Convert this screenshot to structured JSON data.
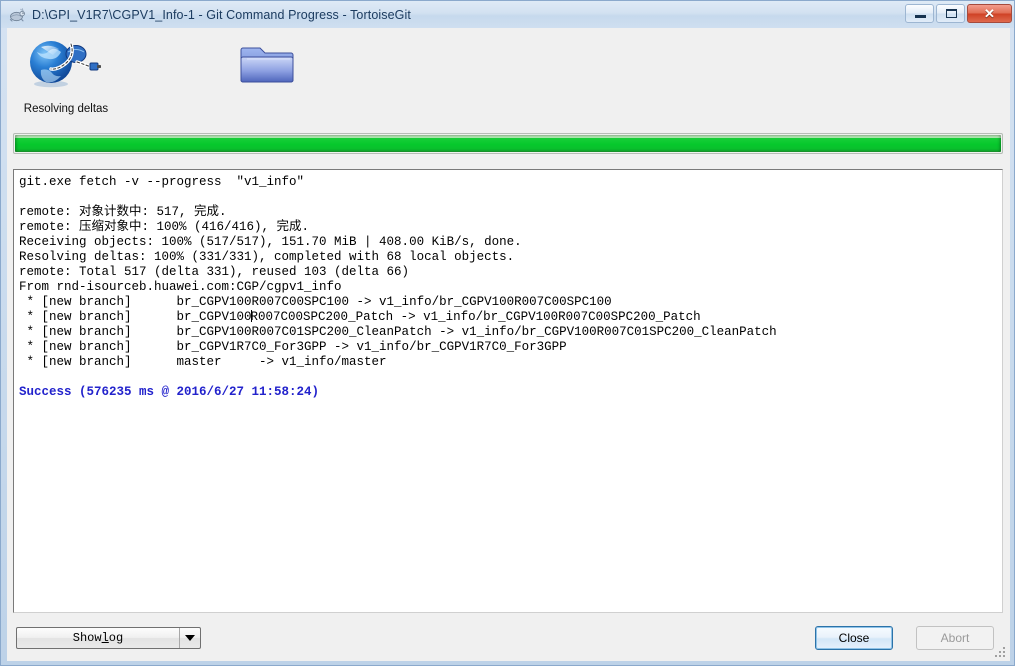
{
  "window": {
    "title": "D:\\GPI_V1R7\\CGPV1_Info-1 - Git Command Progress - TortoiseGit",
    "app_icon": "tortoise-icon",
    "controls": {
      "minimize_label": "Minimize",
      "maximize_label": "Maximize",
      "close_label": "Close"
    },
    "colors": {
      "titlebar": "#d2e1f1",
      "frame_border": "#8ba9cc",
      "dialog_bg": "#f0f0f0",
      "progress_green": "#06c82c",
      "success_text": "#2222cc",
      "default_button_border": "#2c72a8"
    }
  },
  "icons": {
    "network": {
      "name": "globe-network-icon",
      "caption": "Resolving deltas"
    },
    "folder": {
      "name": "folder-icon",
      "caption": ""
    }
  },
  "progress": {
    "percent": 100,
    "value_label": "100%"
  },
  "log": {
    "lines": [
      {
        "text": "git.exe fetch -v --progress  \"v1_info\"",
        "style": "normal"
      },
      {
        "text": "",
        "style": "blank"
      },
      {
        "text": "remote: 对象计数中: 517, 完成.",
        "style": "normal"
      },
      {
        "text": "remote: 压缩对象中: 100% (416/416), 完成.",
        "style": "normal"
      },
      {
        "text": "Receiving objects: 100% (517/517), 151.70 MiB | 408.00 KiB/s, done.",
        "style": "normal"
      },
      {
        "text": "Resolving deltas: 100% (331/331), completed with 68 local objects.",
        "style": "normal"
      },
      {
        "text": "remote: Total 517 (delta 331), reused 103 (delta 66)",
        "style": "normal"
      },
      {
        "text": "From rnd-isourceb.huawei.com:CGP/cgpv1_info",
        "style": "normal"
      },
      {
        "text": " * [new branch]      br_CGPV100R007C00SPC100 -> v1_info/br_CGPV100R007C00SPC100",
        "style": "normal"
      },
      {
        "text": " * [new branch]      br_CGPV100R007C00SPC200_Patch -> v1_info/br_CGPV100R007C00SPC200_Patch",
        "style": "caret",
        "caret_after": 31
      },
      {
        "text": " * [new branch]      br_CGPV100R007C01SPC200_CleanPatch -> v1_info/br_CGPV100R007C01SPC200_CleanPatch",
        "style": "normal"
      },
      {
        "text": " * [new branch]      br_CGPV1R7C0_For3GPP -> v1_info/br_CGPV1R7C0_For3GPP",
        "style": "normal"
      },
      {
        "text": " * [new branch]      master     -> v1_info/master",
        "style": "normal"
      },
      {
        "text": "",
        "style": "blank"
      },
      {
        "text": "Success (576235 ms @ 2016/6/27 11:58:24)",
        "style": "success"
      }
    ]
  },
  "footer": {
    "show_log": {
      "label_before": "Show ",
      "label_accel": "l",
      "label_after": "og",
      "full_label": "Show log",
      "dropdown_icon": "chevron-down-icon"
    },
    "close_label": "Close",
    "abort_label": "Abort",
    "abort_enabled": false
  }
}
